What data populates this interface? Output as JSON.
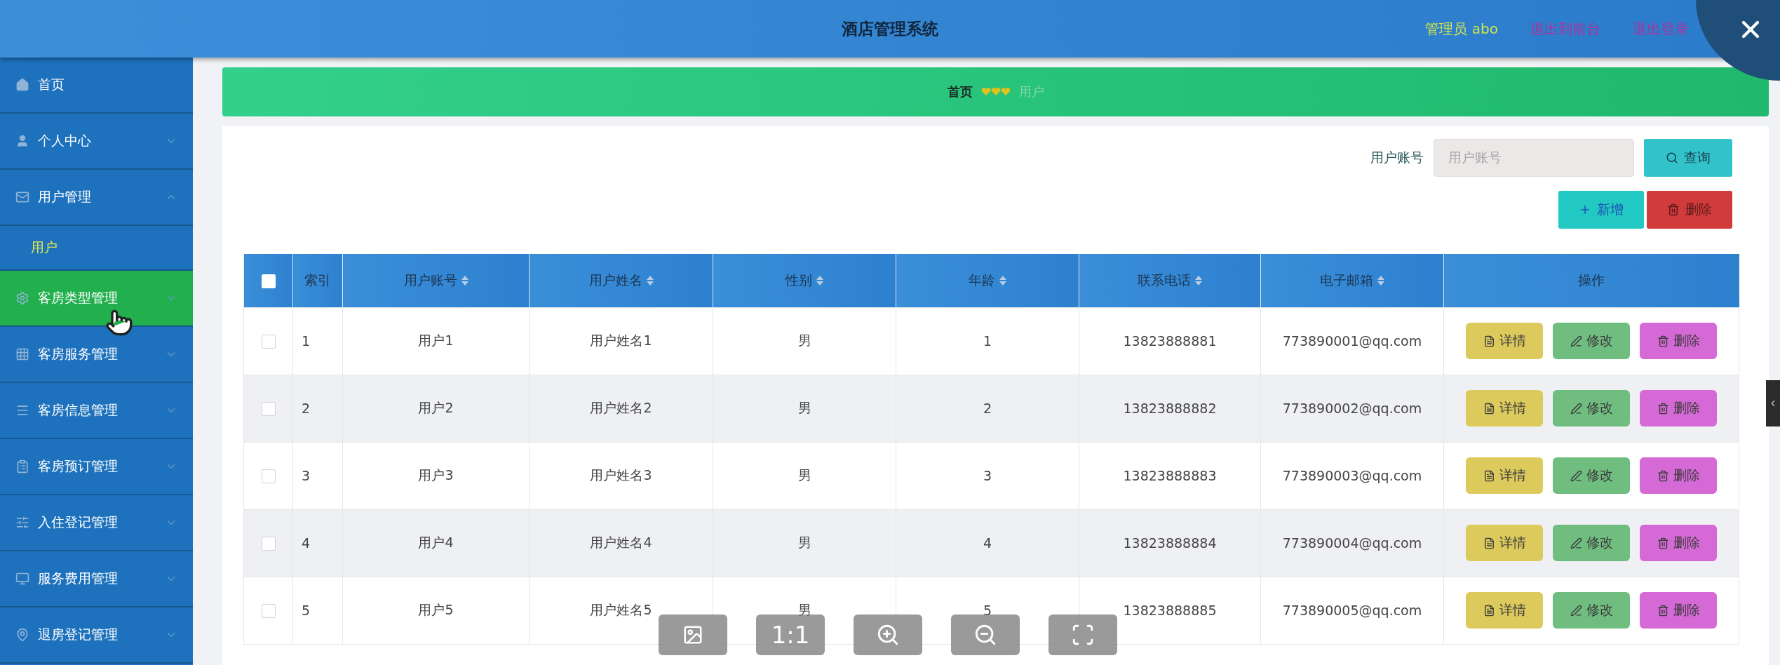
{
  "header": {
    "title": "酒店管理系统",
    "user_label": "管理员 abo",
    "links": [
      "退出到前台",
      "退出登录"
    ]
  },
  "sidebar": {
    "items": [
      {
        "label": "首页",
        "hovered": false
      },
      {
        "label": "个人中心",
        "hovered": false,
        "expanded": false
      },
      {
        "label": "用户管理",
        "hovered": false,
        "expanded": true,
        "children": [
          {
            "label": "用户",
            "selected": true
          }
        ]
      },
      {
        "label": "客房类型管理",
        "hovered": true,
        "expanded": false
      },
      {
        "label": "客房服务管理",
        "hovered": false,
        "expanded": false
      },
      {
        "label": "客房信息管理",
        "hovered": false,
        "expanded": false
      },
      {
        "label": "客房预订管理",
        "hovered": false,
        "expanded": false
      },
      {
        "label": "入住登记管理",
        "hovered": false,
        "expanded": false
      },
      {
        "label": "服务费用管理",
        "hovered": false,
        "expanded": false
      },
      {
        "label": "退房登记管理",
        "hovered": false,
        "expanded": false
      }
    ]
  },
  "breadcrumb": {
    "home": "首页",
    "current": "用户"
  },
  "search": {
    "label": "用户账号",
    "placeholder": "用户账号",
    "button": "查询"
  },
  "actions": [
    {
      "kind": "add",
      "label": "新增"
    },
    {
      "kind": "delete",
      "label": "删除"
    }
  ],
  "table": {
    "select_all": {
      "checked": false
    },
    "columns": [
      {
        "label": "索引",
        "sortable": false
      },
      {
        "label": "用户账号",
        "sortable": true
      },
      {
        "label": "用户姓名",
        "sortable": true
      },
      {
        "label": "性别",
        "sortable": true
      },
      {
        "label": "年龄",
        "sortable": true
      },
      {
        "label": "联系电话",
        "sortable": true
      },
      {
        "label": "电子邮箱",
        "sortable": true
      },
      {
        "label": "操作",
        "sortable": false
      }
    ],
    "rows": [
      {
        "checked": false,
        "cells": [
          "1",
          "用户1",
          "用户姓名1",
          "男",
          "1",
          "13823888881",
          "773890001@qq.com"
        ],
        "buttons": [
          {
            "kind": "detail",
            "label": "详情"
          },
          {
            "kind": "edit",
            "label": "修改"
          },
          {
            "kind": "delete",
            "label": "删除"
          }
        ]
      },
      {
        "checked": false,
        "cells": [
          "2",
          "用户2",
          "用户姓名2",
          "男",
          "2",
          "13823888882",
          "773890002@qq.com"
        ],
        "buttons": [
          {
            "kind": "detail",
            "label": "详情"
          },
          {
            "kind": "edit",
            "label": "修改"
          },
          {
            "kind": "delete",
            "label": "删除"
          }
        ]
      },
      {
        "checked": false,
        "cells": [
          "3",
          "用户3",
          "用户姓名3",
          "男",
          "3",
          "13823888883",
          "773890003@qq.com"
        ],
        "buttons": [
          {
            "kind": "detail",
            "label": "详情"
          },
          {
            "kind": "edit",
            "label": "修改"
          },
          {
            "kind": "delete",
            "label": "删除"
          }
        ]
      },
      {
        "checked": false,
        "cells": [
          "4",
          "用户4",
          "用户姓名4",
          "男",
          "4",
          "13823888884",
          "773890004@qq.com"
        ],
        "buttons": [
          {
            "kind": "detail",
            "label": "详情"
          },
          {
            "kind": "edit",
            "label": "修改"
          },
          {
            "kind": "delete",
            "label": "删除"
          }
        ]
      },
      {
        "checked": false,
        "cells": [
          "5",
          "用户5",
          "用户姓名5",
          "男",
          "5",
          "13823888885",
          "773890005@qq.com"
        ],
        "buttons": [
          {
            "kind": "detail",
            "label": "详情"
          },
          {
            "kind": "edit",
            "label": "修改"
          },
          {
            "kind": "delete",
            "label": "删除"
          }
        ]
      }
    ]
  },
  "viewer_toolbar": {
    "actual_size": "1:1"
  }
}
